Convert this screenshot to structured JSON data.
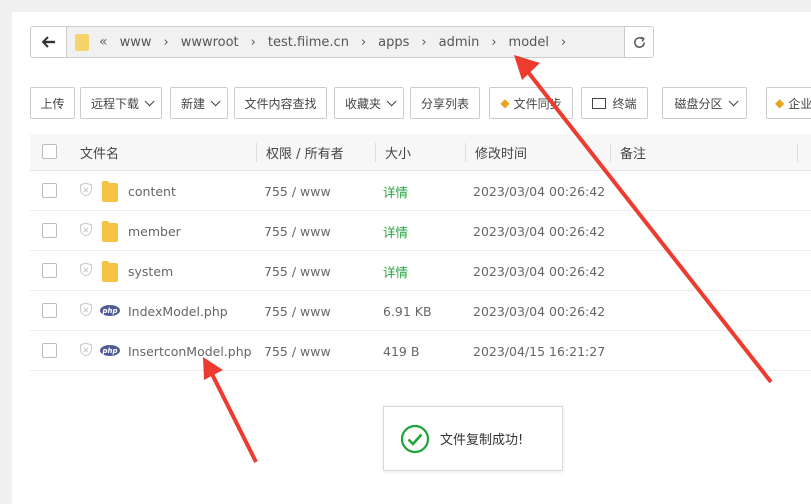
{
  "path": {
    "segments": [
      "www",
      "wwwroot",
      "test.fiime.cn",
      "apps",
      "admin",
      "model"
    ],
    "back_icon": "arrow-left-icon",
    "refresh_icon": "refresh-icon"
  },
  "toolbar": {
    "upload": "上传",
    "remote_download": "远程下载",
    "new": "新建",
    "content_search": "文件内容查找",
    "favorites": "收藏夹",
    "share_list": "分享列表",
    "file_sync": "文件同步",
    "terminal": "终端",
    "disk_partition": "磁盘分区",
    "enterprise": "企业"
  },
  "table": {
    "headers": {
      "name": "文件名",
      "perm": "权限 / 所有者",
      "size": "大小",
      "mtime": "修改时间",
      "note": "备注"
    },
    "rows": [
      {
        "name": "content",
        "type": "folder",
        "perm": "755 / www",
        "size": "详情",
        "mtime": "2023/03/04 00:26:42"
      },
      {
        "name": "member",
        "type": "folder",
        "perm": "755 / www",
        "size": "详情",
        "mtime": "2023/03/04 00:26:42"
      },
      {
        "name": "system",
        "type": "folder",
        "perm": "755 / www",
        "size": "详情",
        "mtime": "2023/03/04 00:26:42"
      },
      {
        "name": "IndexModel.php",
        "type": "php",
        "perm": "755 / www",
        "size": "6.91 KB",
        "mtime": "2023/03/04 00:26:42"
      },
      {
        "name": "InsertconModel.php",
        "type": "php",
        "perm": "755 / www",
        "size": "419 B",
        "mtime": "2023/04/15 16:21:27"
      }
    ]
  },
  "toast": {
    "message": "文件复制成功!",
    "icon": "check-circle-icon"
  },
  "colors": {
    "accent_green": "#20a53a",
    "annotation_red": "#ee3b30",
    "folder_yellow": "#f6c444",
    "php_badge": "#4f5b93"
  }
}
